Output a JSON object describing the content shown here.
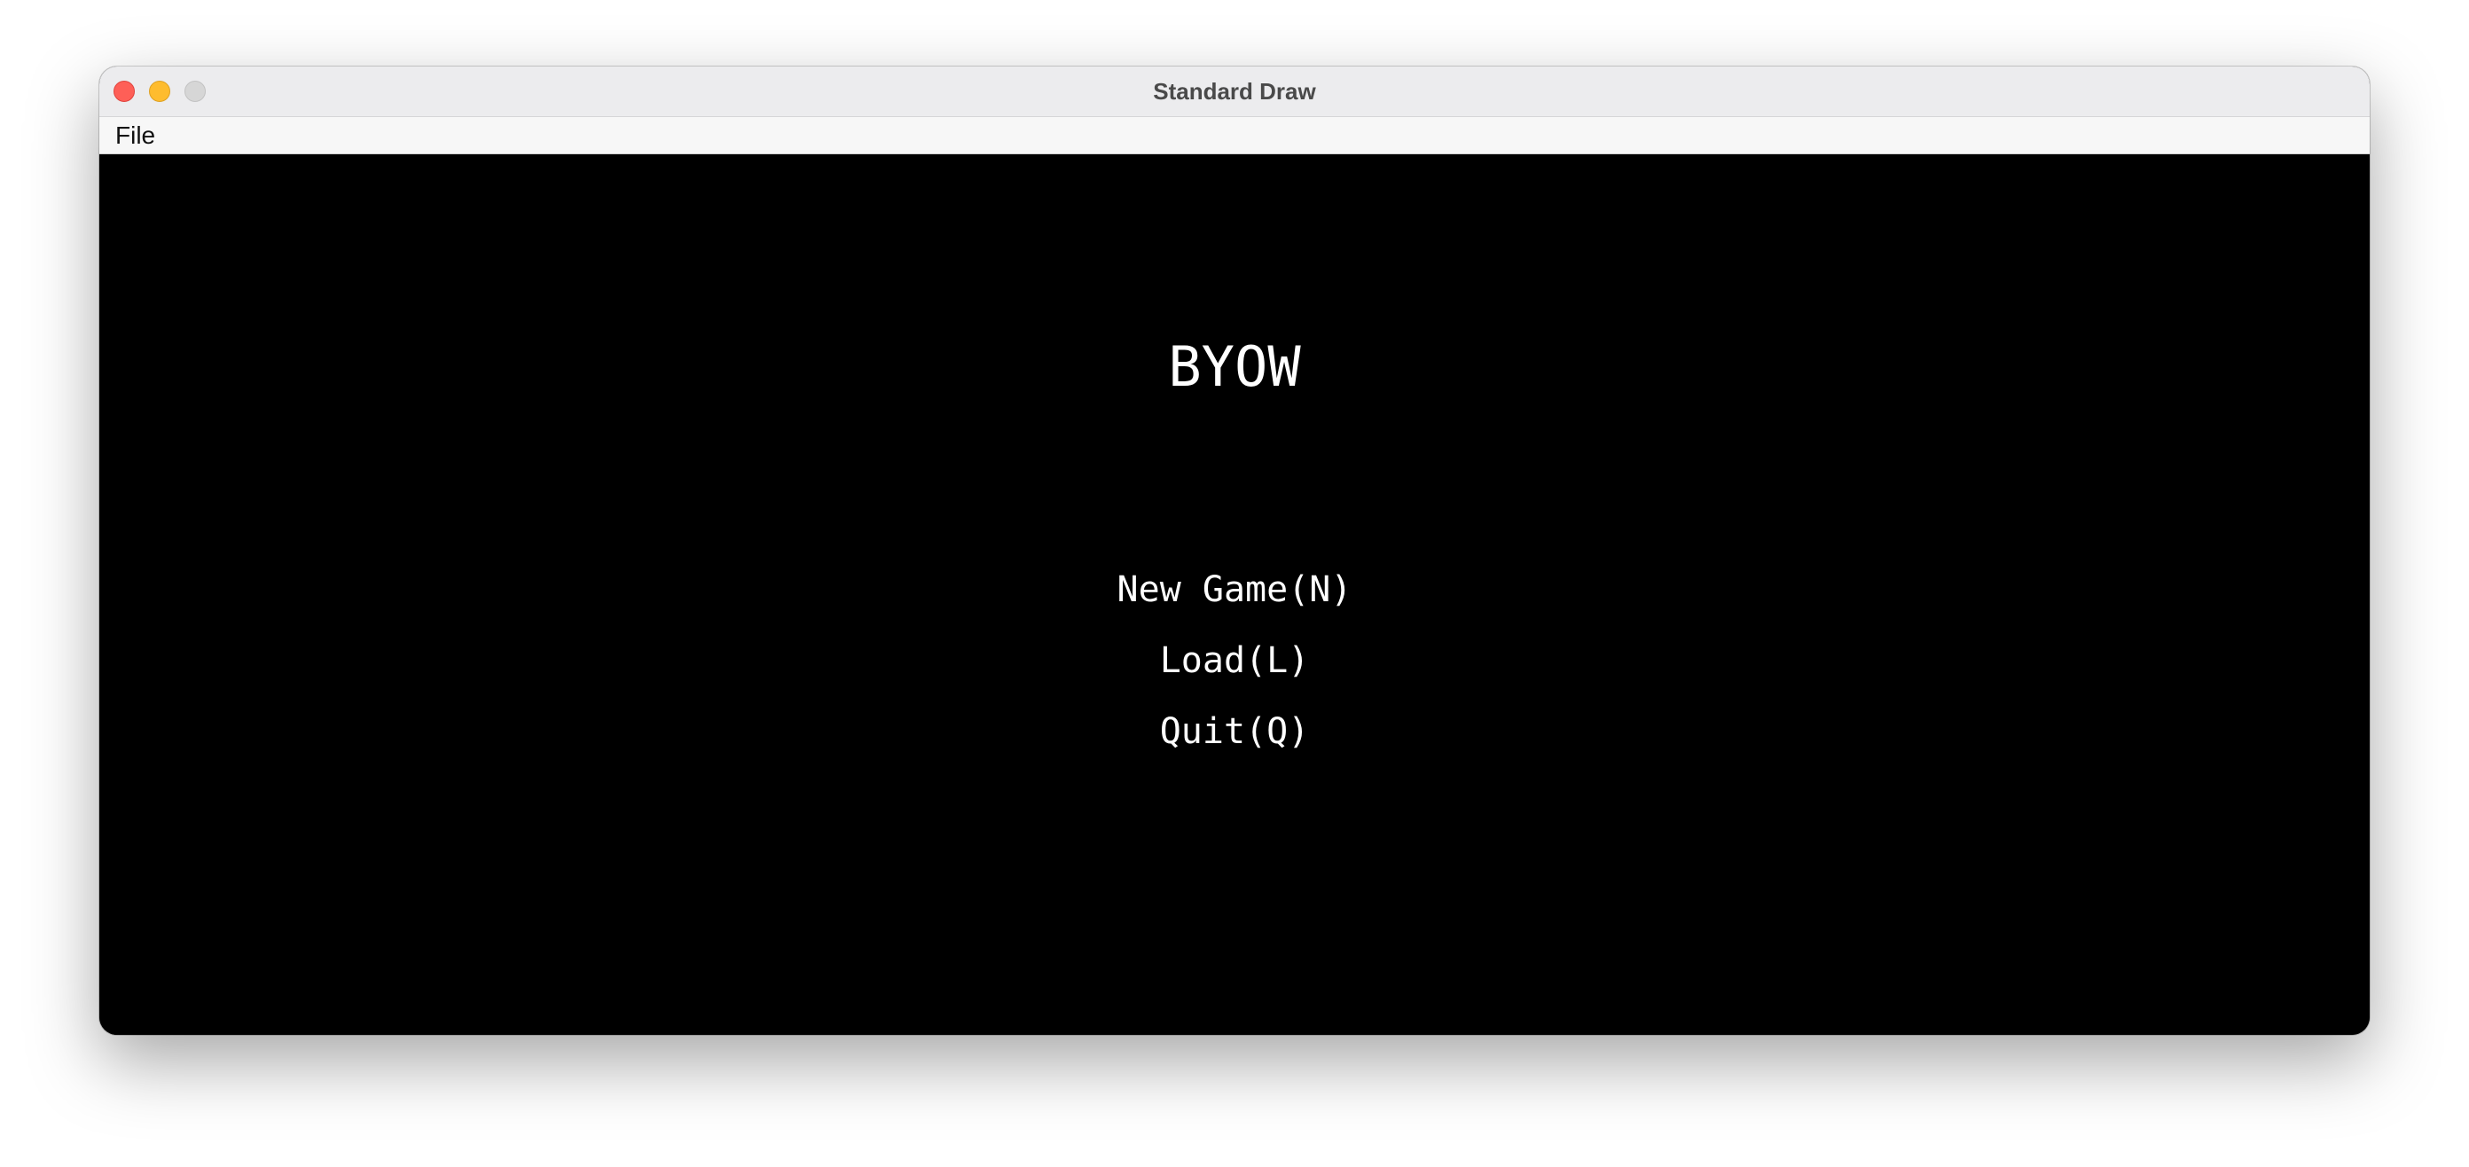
{
  "window": {
    "title": "Standard Draw"
  },
  "menubar": {
    "items": [
      {
        "label": "File"
      }
    ]
  },
  "game": {
    "title": "BYOW",
    "options": [
      {
        "label": "New Game(N)"
      },
      {
        "label": "Load(L)"
      },
      {
        "label": "Quit(Q)"
      }
    ]
  },
  "colors": {
    "canvas_background": "#000000",
    "text": "#ffffff",
    "close": "#fe5f57",
    "minimize": "#febc2e",
    "zoom_disabled": "#d6d6d6"
  }
}
